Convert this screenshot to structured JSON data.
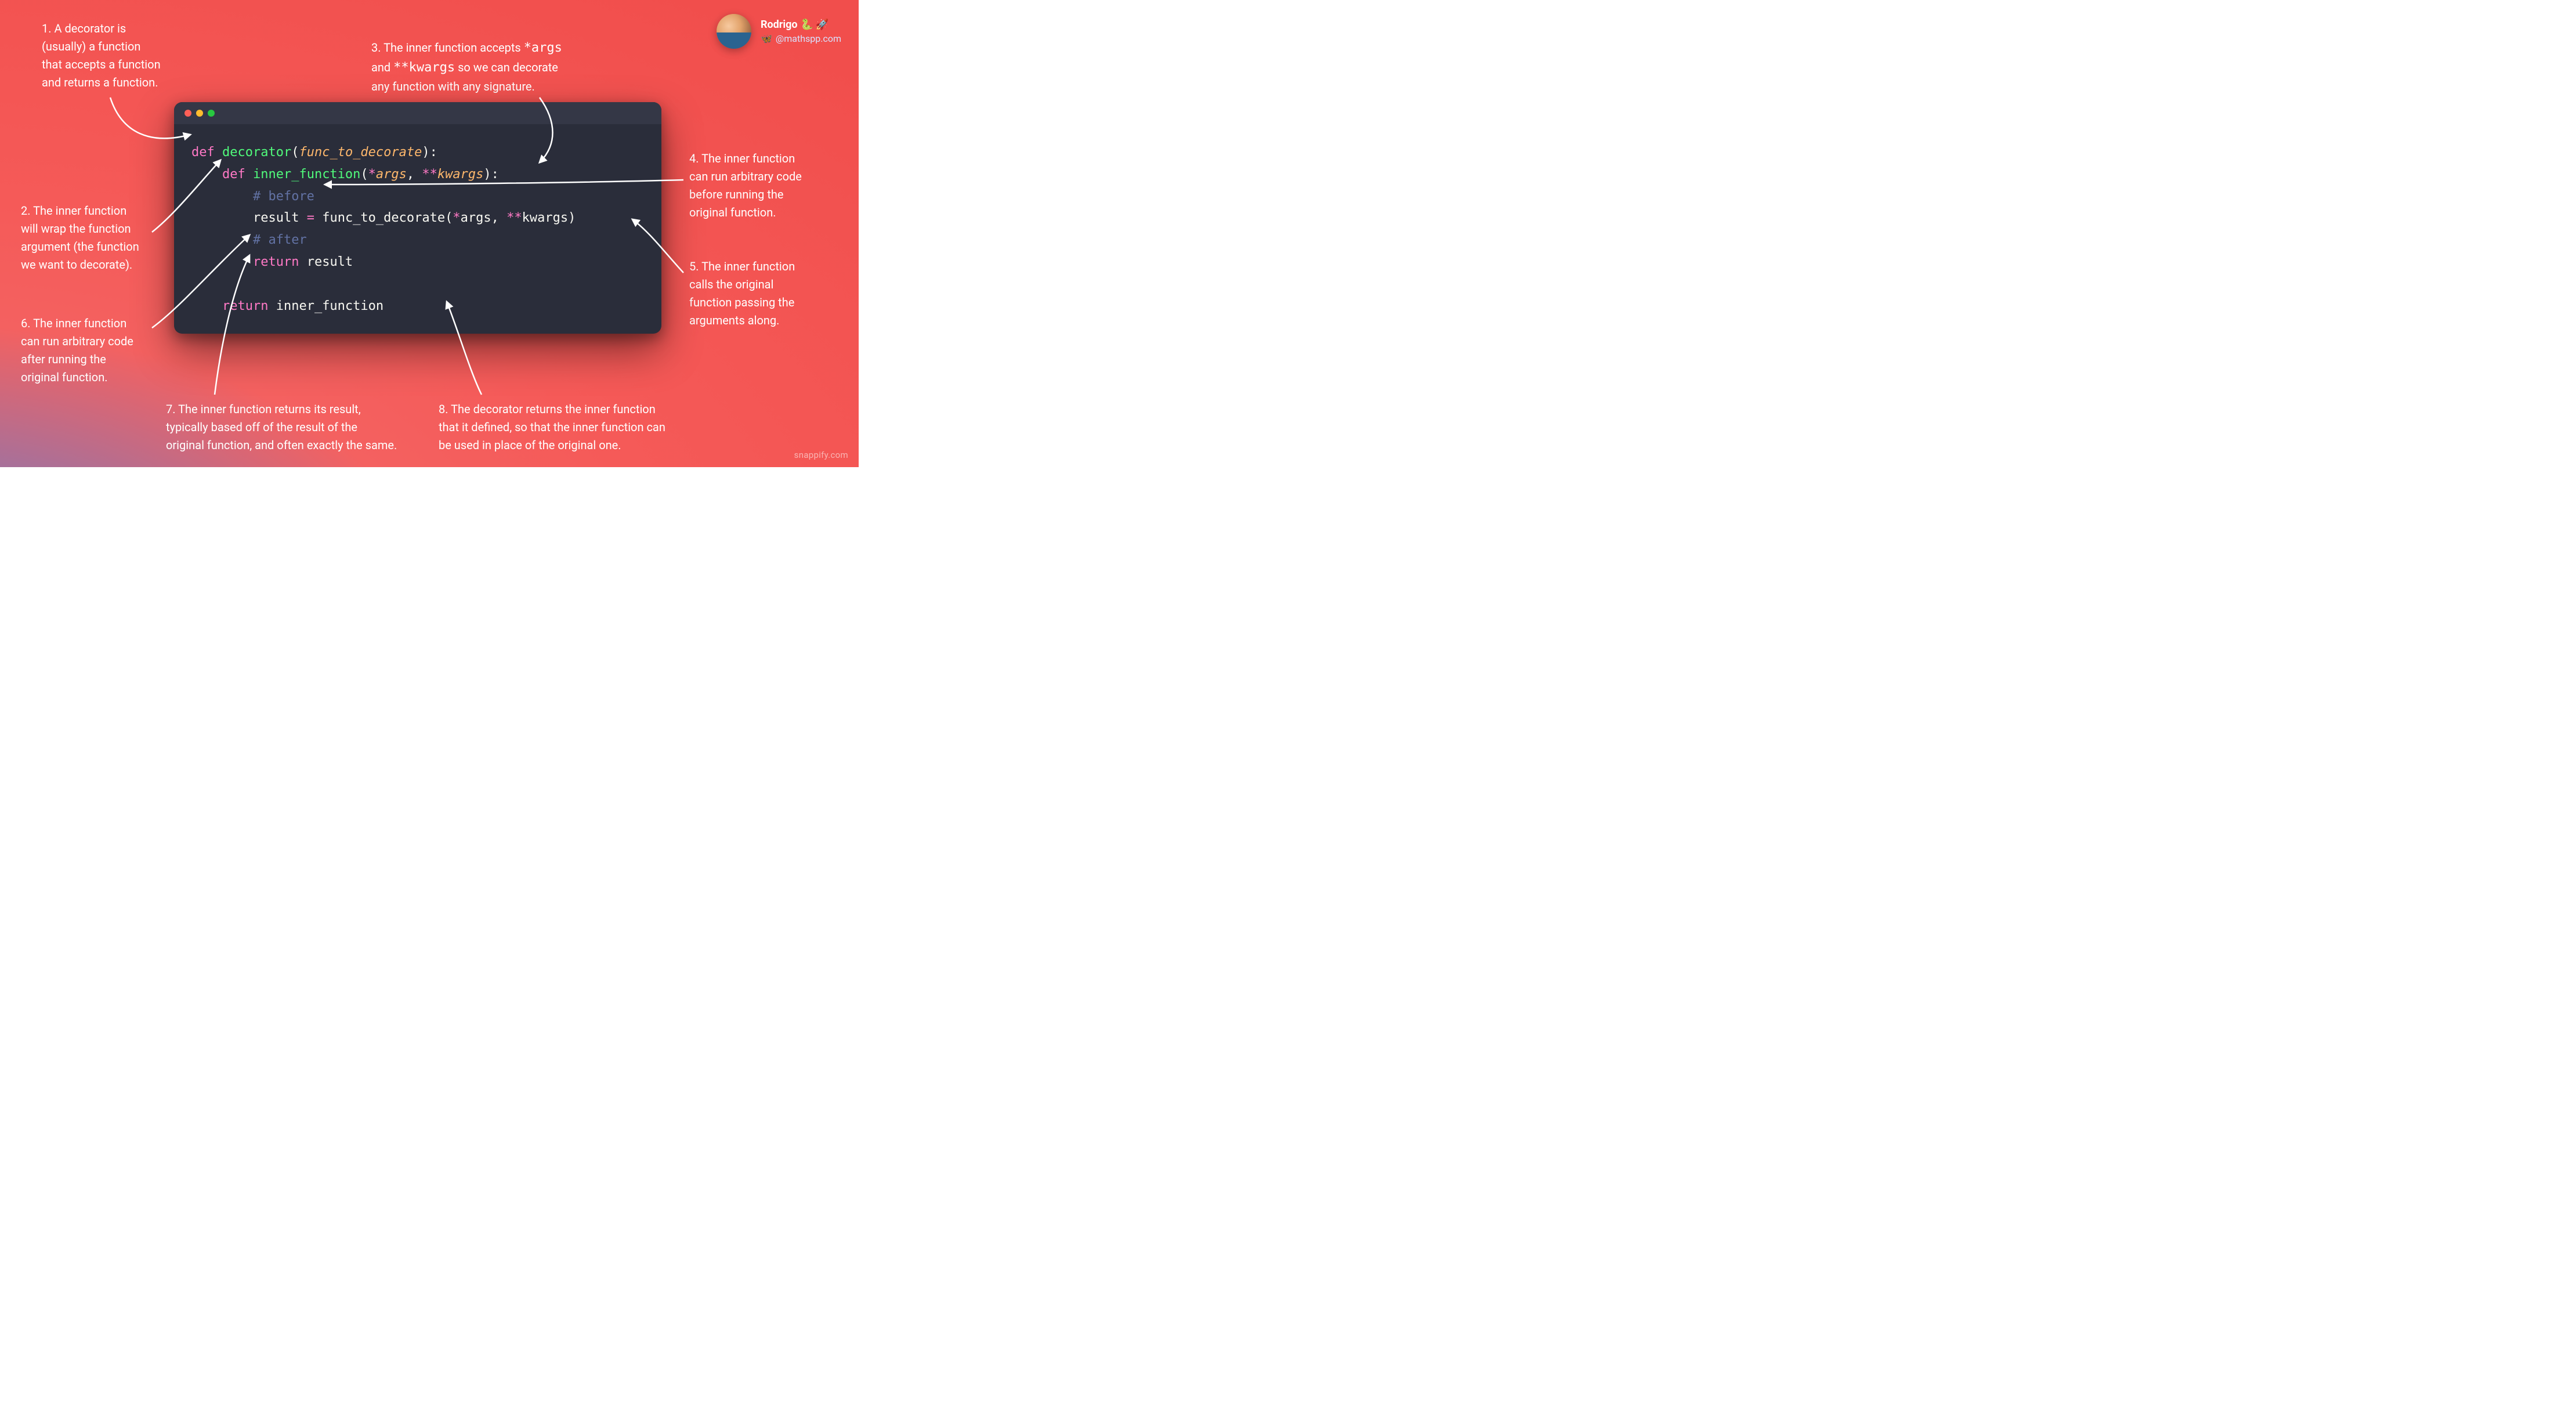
{
  "profile": {
    "name": "Rodrigo 🐍 🚀",
    "handle": "@mathspp.com"
  },
  "watermark": "snappify.com",
  "annotations": {
    "a1_line1": "1.  A decorator is",
    "a1_line2": "(usually) a function",
    "a1_line3": "that accepts a function",
    "a1_line4": "and returns a function.",
    "a2_line1": "2. The inner function",
    "a2_line2": "will wrap the function",
    "a2_line3": "argument (the function",
    "a2_line4": "we want to decorate).",
    "a3_pre": "3. The inner function accepts ",
    "a3_args": "*args",
    "a3_mid": "and ",
    "a3_kwargs": "**kwargs",
    "a3_post": " so we can decorate",
    "a3_line3": "any function with any signature.",
    "a4_line1": "4. The inner function",
    "a4_line2": "can run arbitrary code",
    "a4_line3": "before running the",
    "a4_line4": "original function.",
    "a5_line1": "5. The inner function",
    "a5_line2": "calls the original",
    "a5_line3": "function passing the",
    "a5_line4": "arguments along.",
    "a6_line1": "6. The inner function",
    "a6_line2": "can run arbitrary code",
    "a6_line3": "after running the",
    "a6_line4": "original function.",
    "a7_line1": "7. The inner function returns its result,",
    "a7_line2": "typically based off of the result of the",
    "a7_line3": "original function, and often exactly the same.",
    "a8_line1": "8. The decorator returns the inner function",
    "a8_line2": "that it defined, so that the inner function can",
    "a8_line3": "be used in place of the original one."
  },
  "code": {
    "kw_def": "def",
    "fn_decorator": "decorator",
    "param_func": "func_to_decorate",
    "fn_inner": "inner_function",
    "args": "args",
    "kwargs": "kwargs",
    "comment_before": "# before",
    "comment_after": "# after",
    "name_result": "result",
    "kw_return": "return",
    "star": "*",
    "star2": "**",
    "eq": "=",
    "lp": "(",
    "rp": ")",
    "colon": ":",
    "comma": ","
  }
}
